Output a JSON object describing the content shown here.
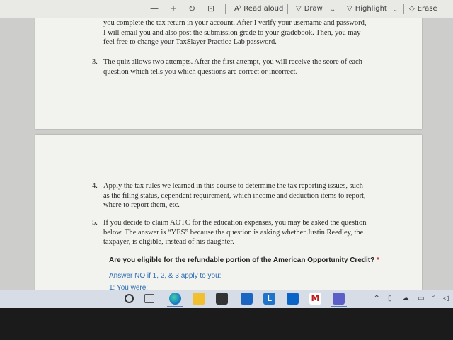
{
  "toolbar": {
    "minus_icon": "minus-icon",
    "plus_icon": "plus-icon",
    "rotate_icon": "rotate-icon",
    "fit_icon": "fit-page-icon",
    "read_aloud": "Read aloud",
    "draw": "Draw",
    "highlight": "Highlight",
    "erase": "Erase"
  },
  "page1": {
    "lines": [
      "you complete the tax return in your account. After I verify your username and password,",
      "I will email you and also post the submission grade to your gradebook. Then, you may",
      "feel free to change your TaxSlayer Practice Lab password."
    ],
    "item3": {
      "num": "3.",
      "lines": [
        "The quiz allows two attempts. After the first attempt, you will receive the score of each",
        "question which tells you which questions are correct or incorrect."
      ]
    }
  },
  "page2": {
    "item4": {
      "num": "4.",
      "lines": [
        "Apply the tax rules we learned in this course to determine the tax reporting issues, such",
        "as the filing status, dependent requirement, which income and deduction items to report,",
        "where to report them, etc."
      ]
    },
    "item5": {
      "num": "5.",
      "lines": [
        "If you decide to claim AOTC for the education expenses, you may be asked the question",
        "below. The answer is “YES” because the question is asking whether Justin Reedley, the",
        "taxpayer, is eligible, instead of his daughter."
      ]
    },
    "question": {
      "title": "Are you eligible for the refundable portion of the American Opportunity Credit?",
      "required_mark": "*",
      "subtitle": "Answer NO if 1, 2, & 3 apply to you:",
      "first_item": "1: You were:"
    }
  },
  "colors": {
    "question_blue": "#2e6fb3",
    "required_red": "#c62828"
  }
}
